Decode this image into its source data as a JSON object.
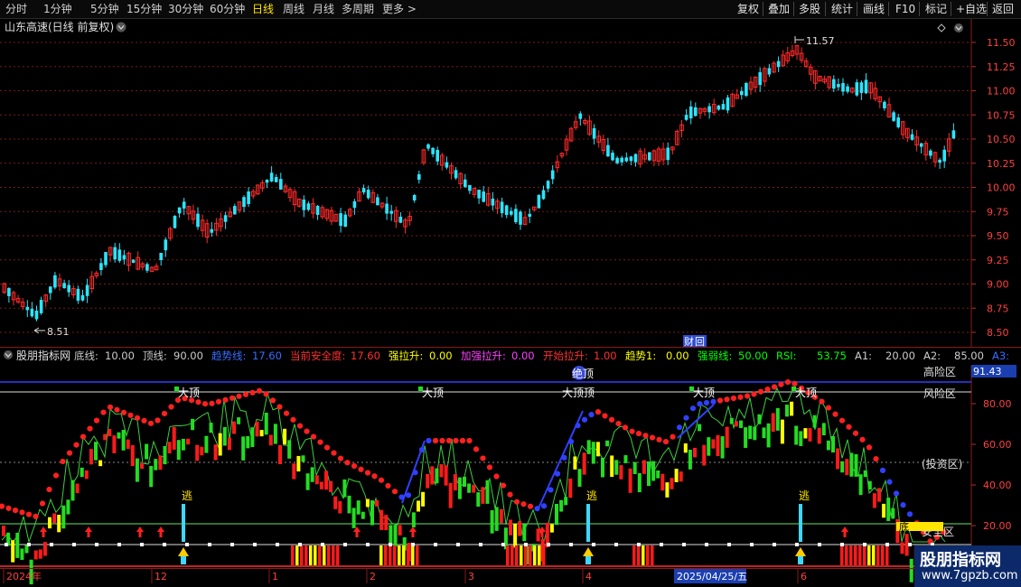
{
  "toolbar": {
    "periods": [
      "分时",
      "1分钟",
      "5分钟",
      "15分钟",
      "30分钟",
      "60分钟",
      "日线",
      "周线",
      "月线",
      "多周期",
      "更多 >"
    ],
    "active_index": 6,
    "actions": [
      "复权",
      "叠加",
      "多股",
      "统计",
      "画线",
      "F10",
      "标记",
      "+自选",
      "返回"
    ]
  },
  "main_chart": {
    "title": "山东高速(日线 前复权)",
    "high_label": "11.57",
    "low_label": "8.51",
    "finance_badge": "财",
    "finance_badge_2": "回",
    "y_ticks": [
      "11.50",
      "11.25",
      "11.00",
      "10.75",
      "10.50",
      "10.25",
      "10.00",
      "9.75",
      "9.50",
      "9.25",
      "9.00",
      "8.75",
      "8.50"
    ]
  },
  "indicator": {
    "name": "股朋指标网",
    "params": [
      {
        "label": "底线:",
        "value": "10.00",
        "color": "#cccccc"
      },
      {
        "label": "顶线:",
        "value": "90.00",
        "color": "#cccccc"
      },
      {
        "label": "趋势线:",
        "value": "17.60",
        "color": "#3a6cff"
      },
      {
        "label": "当前安全度:",
        "value": "17.60",
        "color": "#ff3030"
      },
      {
        "label": "强拉升:",
        "value": "0.00",
        "color": "#ffff00"
      },
      {
        "label": "加强拉升:",
        "value": "0.00",
        "color": "#ff40ff"
      },
      {
        "label": "开始拉升:",
        "value": "1.00",
        "color": "#ff3030"
      },
      {
        "label": "趋势1:",
        "value": "0.00",
        "color": "#ffff00"
      },
      {
        "label": "强弱线:",
        "value": "50.00",
        "color": "#00ff00"
      },
      {
        "label": "RSI:",
        "value": "53.75",
        "color": "#00ff00"
      },
      {
        "label": "A1:",
        "value": "20.00",
        "color": "#cccccc"
      },
      {
        "label": "A2:",
        "value": "85.00",
        "color": "#cccccc"
      },
      {
        "label": "A3:",
        "value": "90.00",
        "color": "#3a6cff"
      }
    ],
    "zones": {
      "high": "高险区",
      "risk": "风险区",
      "invest": "(投资区)",
      "safe": "安全区"
    },
    "current_value": "91.43",
    "y_ticks": [
      "80.00",
      "60.00",
      "40.00",
      "20.00"
    ],
    "signals": {
      "top": "大顶",
      "escape": "逃",
      "bottom": "底",
      "top_alt": "大顶顶",
      "blue_badge": "绝顶"
    }
  },
  "date_axis": {
    "labels": [
      "2024年",
      "12",
      "1",
      "2",
      "3",
      "4",
      "5",
      "6"
    ],
    "cursor_label": "2025/04/25/五"
  },
  "watermark": {
    "line1": "股朋指标网",
    "line2": "www.7gpzb.com"
  },
  "colors": {
    "up": "#ff2a2a",
    "down": "#2ae6ff",
    "green": "#00e000",
    "yellow": "#ffff00",
    "blue": "#3040ff",
    "grid": "#7a1a1a"
  }
}
